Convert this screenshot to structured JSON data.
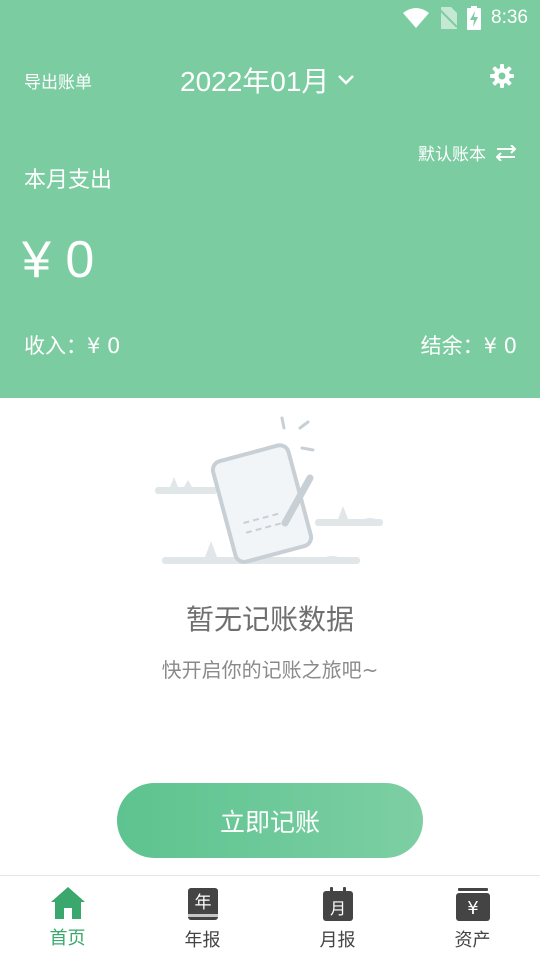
{
  "status_bar": {
    "time": "8:36"
  },
  "header": {
    "export_label": "导出账单",
    "month": "2022年01月",
    "book_label": "默认账本",
    "expense_label": "本月支出",
    "expense_amount": "¥ 0",
    "income_text": "收入：¥ 0",
    "balance_text": "结余：¥ 0"
  },
  "empty_state": {
    "title": "暂无记账数据",
    "subtitle": "快开启你的记账之旅吧~"
  },
  "record_button": {
    "label": "立即记账"
  },
  "tabs": [
    {
      "label": "首页",
      "icon": "home-icon",
      "active": true
    },
    {
      "label": "年报",
      "icon": "year-report-icon",
      "glyph": "年"
    },
    {
      "label": "月报",
      "icon": "month-report-icon",
      "glyph": "月"
    },
    {
      "label": "资产",
      "icon": "assets-icon",
      "glyph": "¥"
    }
  ],
  "colors": {
    "header_bg": "#7ccca1",
    "accent": "#3aa86c",
    "button_start": "#5dc38f",
    "button_end": "#7dcfa3"
  }
}
